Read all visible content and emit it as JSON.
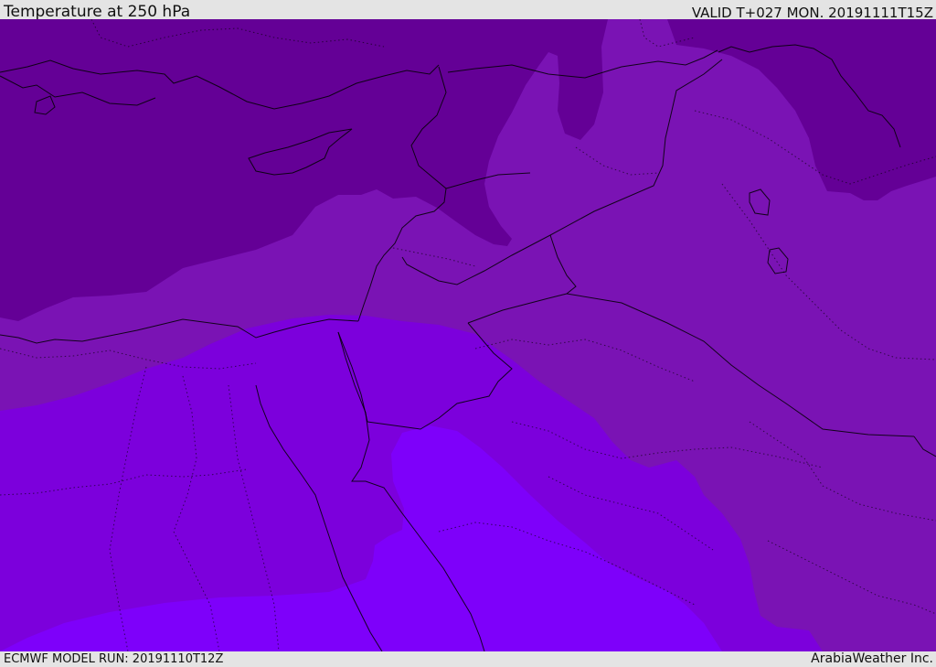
{
  "header": {
    "title": "Temperature at 250 hPa",
    "valid": "VALID T+027 MON. 20191111T15Z"
  },
  "footer": {
    "model_run": "ECMWF MODEL RUN: 20191110T12Z",
    "credit": "ArabiaWeather Inc."
  },
  "colors": {
    "band_coldest": "#640096",
    "band_cold": "#7a13b4",
    "band_mild": "#7c00dc",
    "band_warm": "#7e00fa",
    "bar_background": "#e4e4e4"
  }
}
